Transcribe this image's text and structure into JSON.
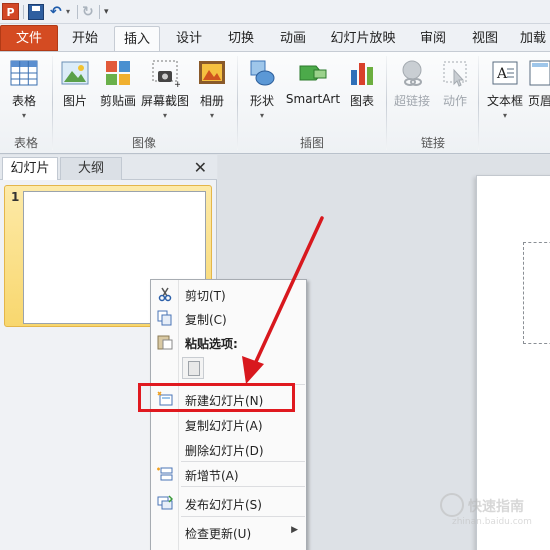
{
  "qat": {
    "app_icon": "P",
    "icons": [
      "save-icon",
      "undo-icon",
      "redo-icon",
      "customize-qat-icon"
    ]
  },
  "ribbon_tabs": {
    "file": "文件",
    "home": "开始",
    "insert": "插入",
    "design": "设计",
    "transitions": "切换",
    "animations": "动画",
    "slideshow": "幻灯片放映",
    "review": "审阅",
    "view": "视图",
    "addins": "加载"
  },
  "ribbon": {
    "table": "表格",
    "picture": "图片",
    "clipart": "剪贴画",
    "screenshot": "屏幕截图",
    "album": "相册",
    "shapes": "形状",
    "smartart": "SmartArt",
    "chart": "图表",
    "hyperlink": "超链接",
    "action": "动作",
    "textbox": "文本框",
    "header": "页眉",
    "groups": {
      "tables": "表格",
      "images": "图像",
      "illustrations": "插图",
      "links": "链接"
    }
  },
  "slides_pane": {
    "tab_slides": "幻灯片",
    "tab_outline": "大纲",
    "close": "✕",
    "slide_number": "1"
  },
  "context_menu": {
    "cut": "剪切(T)",
    "copy": "复制(C)",
    "paste_options": "粘贴选项:",
    "new_slide": "新建幻灯片(N)",
    "duplicate_slide": "复制幻灯片(A)",
    "delete_slide": "删除幻灯片(D)",
    "new_section": "新增节(A)",
    "publish_slides": "发布幻灯片(S)",
    "check_updates": "检查更新(U)"
  },
  "watermark": {
    "text": "快速指南",
    "url": "zhinan.baidu.com"
  },
  "colors": {
    "file_tab": "#d44b22",
    "annotation_red": "#e0191f",
    "thumbnail_selected": "#f8d76e"
  }
}
